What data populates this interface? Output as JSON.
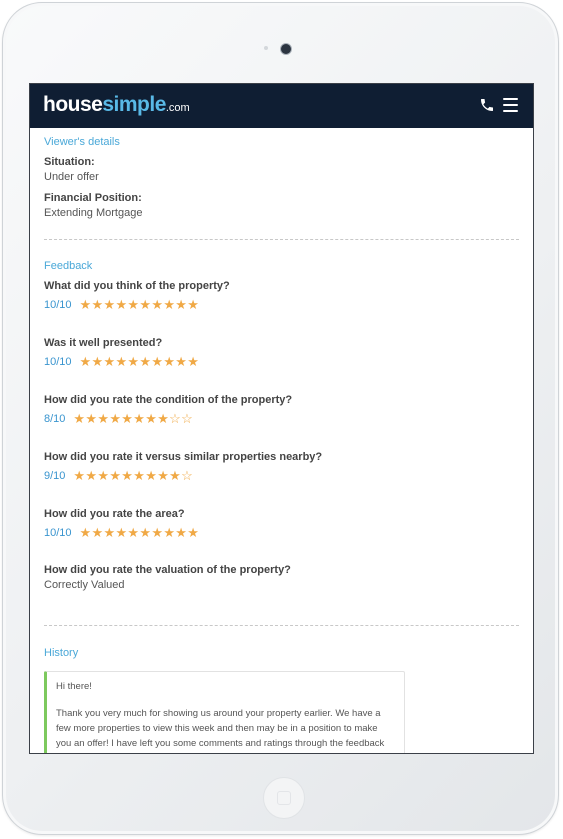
{
  "header": {
    "logo_main": "house",
    "logo_accent": "simple",
    "logo_tld": ".com"
  },
  "viewer_details": {
    "heading": "Viewer's details",
    "situation_label": "Situation:",
    "situation_value": "Under offer",
    "financial_label": "Financial Position:",
    "financial_value": "Extending Mortgage"
  },
  "feedback": {
    "heading": "Feedback",
    "questions": [
      {
        "question": "What did you think of the property?",
        "score": "10/10",
        "rating": 10
      },
      {
        "question": "Was it well presented?",
        "score": "10/10",
        "rating": 10
      },
      {
        "question": "How did you rate the condition of the property?",
        "score": "8/10",
        "rating": 8
      },
      {
        "question": "How did you rate it versus similar properties nearby?",
        "score": "9/10",
        "rating": 9
      },
      {
        "question": "How did you rate the area?",
        "score": "10/10",
        "rating": 10
      }
    ],
    "valuation_question": "How did you rate the valuation of the property?",
    "valuation_answer": "Correctly Valued"
  },
  "history": {
    "heading": "History",
    "greeting": "Hi there!",
    "body": "Thank you very much for showing us around your property earlier. We have a few more properties to view this week and then may be in a position to make you an offer! I have left you some comments and ratings through the feedback system."
  },
  "colors": {
    "navbar": "#0f1e33",
    "accent": "#4aa8d8",
    "star": "#f0a946",
    "message_border": "#7dc95e"
  },
  "icons": {
    "phone": "phone-icon",
    "menu": "hamburger-menu-icon",
    "star_filled": "star-filled-icon",
    "star_empty": "star-outline-icon"
  }
}
